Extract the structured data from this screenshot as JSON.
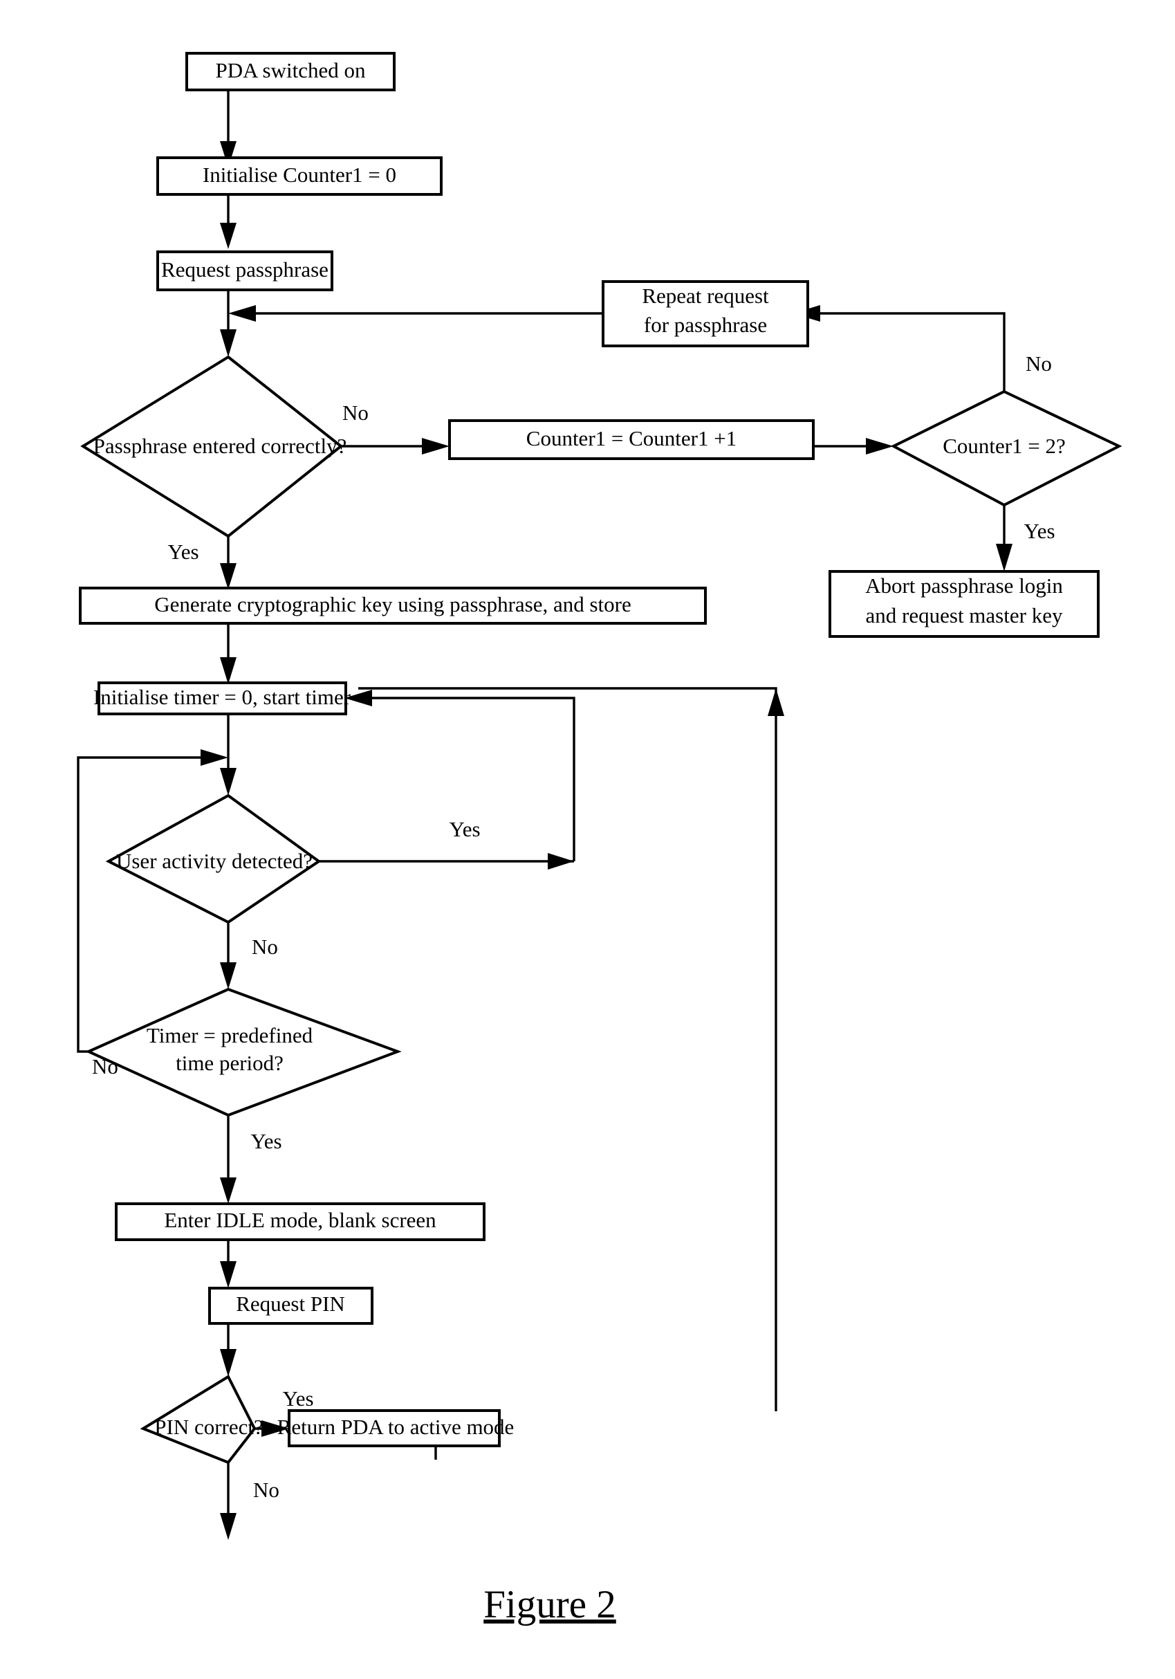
{
  "figure": {
    "caption": "Figure 2"
  },
  "nodes": {
    "pda_on": {
      "label": "PDA switched on",
      "shape": "box"
    },
    "init_counter": {
      "label": "Initialise Counter1 = 0",
      "shape": "box"
    },
    "request_passphrase": {
      "label": "Request passphrase",
      "shape": "box"
    },
    "repeat_request_l1": {
      "label": "Repeat request",
      "shape": "box"
    },
    "repeat_request_l2": {
      "label": "for passphrase",
      "shape": "box"
    },
    "passphrase_correct": {
      "label": "Passphrase entered correctly?",
      "shape": "diamond"
    },
    "counter_increment": {
      "label": "Counter1 = Counter1 +1",
      "shape": "box"
    },
    "counter_equals_two": {
      "label": "Counter1 = 2?",
      "shape": "diamond"
    },
    "abort_login_l1": {
      "label": "Abort passphrase login",
      "shape": "box"
    },
    "abort_login_l2": {
      "label": "and request master key",
      "shape": "box"
    },
    "generate_key": {
      "label": "Generate cryptographic key using passphrase, and store",
      "shape": "box"
    },
    "init_timer": {
      "label": "Initialise timer = 0, start timer",
      "shape": "box"
    },
    "user_activity": {
      "label": "User activity detected?",
      "shape": "diamond"
    },
    "timer_predefined_l1": {
      "label": "Timer = predefined",
      "shape": "diamond"
    },
    "timer_predefined_l2": {
      "label": "time period?",
      "shape": "diamond"
    },
    "enter_idle": {
      "label": "Enter IDLE mode, blank screen",
      "shape": "box"
    },
    "request_pin": {
      "label": "Request PIN",
      "shape": "box"
    },
    "pin_correct": {
      "label": "PIN correct?",
      "shape": "diamond"
    },
    "return_active": {
      "label": "Return PDA to active mode",
      "shape": "box"
    }
  },
  "edge_labels": {
    "passphrase_no": "No",
    "passphrase_yes": "Yes",
    "counter_two_no": "No",
    "counter_two_yes": "Yes",
    "activity_yes": "Yes",
    "activity_no": "No",
    "timer_no": "No",
    "timer_yes": "Yes",
    "pin_yes": "Yes",
    "pin_no": "No"
  },
  "colors": {
    "ink": "#000000",
    "paper": "#ffffff"
  }
}
